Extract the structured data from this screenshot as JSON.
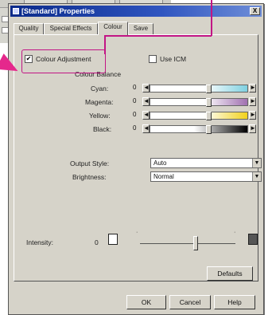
{
  "dialog": {
    "title": "[Standard] Properties",
    "close_label": "X"
  },
  "tabs": [
    {
      "label": "Quality"
    },
    {
      "label": "Special Effects"
    },
    {
      "label": "Colour"
    },
    {
      "label": "Save"
    }
  ],
  "colour_adjustment": {
    "checkbox_mark": "✔",
    "label": "Colour Adjustment",
    "checked": true
  },
  "use_icm": {
    "label": "Use ICM",
    "checked": false
  },
  "colour_balance": {
    "heading": "Colour Balance",
    "rows": [
      {
        "label": "Cyan:",
        "value": "0",
        "color": "#7fd0e0"
      },
      {
        "label": "Magenta:",
        "value": "0",
        "color": "#a070b0"
      },
      {
        "label": "Yellow:",
        "value": "0",
        "color": "#f2d21c"
      },
      {
        "label": "Black:",
        "value": "0",
        "color": "#000000"
      }
    ],
    "decrement_glyph": "◄",
    "increment_glyph": "►"
  },
  "output_style": {
    "label": "Output Style:",
    "value": "Auto"
  },
  "brightness": {
    "label": "Brightness:",
    "value": "Normal"
  },
  "dropdown_glyph": "▼",
  "intensity": {
    "label": "Intensity:",
    "value": "0",
    "level": 0.5
  },
  "buttons": {
    "defaults": "Defaults",
    "ok": "OK",
    "cancel": "Cancel",
    "help": "Help"
  },
  "colors": {
    "highlight": "#c21585",
    "arrow": "#e5288c",
    "title_bar": "#0a2a8a"
  }
}
